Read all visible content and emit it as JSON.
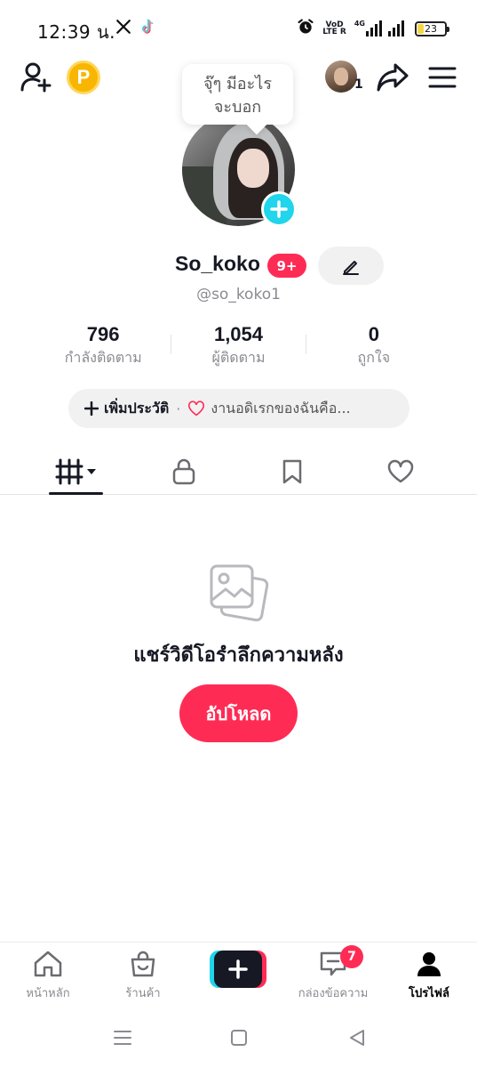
{
  "status_bar": {
    "time": "12:39 น.",
    "battery_level": "23",
    "battery_fraction": 0.23,
    "network_label_top": "VoD",
    "network_label_bottom": "LTE R",
    "network_type": "4G",
    "icons": [
      "x-logo-icon",
      "tiktok-icon",
      "alarm-icon",
      "signal-icon",
      "battery-icon"
    ]
  },
  "header": {
    "coin_letter": "P",
    "friend_count": "1",
    "icons": [
      "add-friend-icon",
      "coin-icon",
      "share-icon",
      "menu-icon"
    ]
  },
  "bubble": {
    "line1": "จุ๊ๆ มีอะไร",
    "line2": "จะบอก"
  },
  "profile": {
    "display_name": "So_koko",
    "badge": "9+",
    "username": "@so_koko1"
  },
  "stats": [
    {
      "value": "796",
      "label": "กำลังติดตาม"
    },
    {
      "value": "1,054",
      "label": "ผู้ติดตาม"
    },
    {
      "value": "0",
      "label": "ถูกใจ"
    }
  ],
  "bio": {
    "add_label": "เพิ่มประวัติ",
    "separator": "·",
    "preview": "งานอดิเรกของฉันคือ..."
  },
  "tabs": {
    "items": [
      "videos-tab-icon",
      "lock-icon",
      "bookmark-icon",
      "heart-icon"
    ],
    "active_index": 0
  },
  "empty_state": {
    "title": "แชร์วิดีโอรำลึกความหลัง",
    "upload_label": "อัปโหลด"
  },
  "bottom_nav": {
    "home": "หน้าหลัก",
    "shop": "ร้านค้า",
    "inbox": "กล่องข้อความ",
    "inbox_badge": "7",
    "profile": "โปรไฟล์"
  },
  "colors": {
    "accent": "#fe2c55",
    "cyan": "#20d5ec",
    "text": "#161823",
    "muted": "#8a8b91",
    "pill_bg": "#f1f1f2",
    "coin": "#f8b600"
  }
}
